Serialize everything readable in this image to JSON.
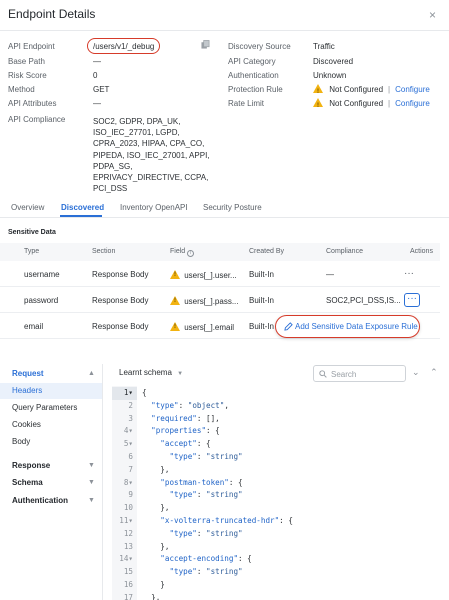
{
  "header": {
    "title": "Endpoint Details",
    "close": "×"
  },
  "details_left": [
    {
      "label": "API Endpoint",
      "value": "/users/v1/_debug"
    },
    {
      "label": "Base Path",
      "value": "—"
    },
    {
      "label": "Risk Score",
      "value": "0"
    },
    {
      "label": "Method",
      "value": "GET"
    },
    {
      "label": "API Attributes",
      "value": "—"
    },
    {
      "label": "API Compliance",
      "value": "SOC2, GDPR, DPA_UK, ISO_IEC_27701, LGPD, CPRA_2023, HIPAA, CPA_CO, PIPEDA, ISO_IEC_27001, APPI, PDPA_SG, EPRIVACY_DIRECTIVE, CCPA, PCI_DSS"
    }
  ],
  "details_right": [
    {
      "label": "Discovery Source",
      "value": "Traffic"
    },
    {
      "label": "API Category",
      "value": "Discovered"
    },
    {
      "label": "Authentication",
      "value": "Unknown"
    },
    {
      "label": "Protection Rule",
      "value": "Not Configured",
      "link": "Configure"
    },
    {
      "label": "Rate Limit",
      "value": "Not Configured",
      "link": "Configure"
    }
  ],
  "tabs": [
    "Overview",
    "Discovered",
    "Inventory OpenAPI",
    "Security Posture"
  ],
  "sensitive": {
    "title": "Sensitive Data",
    "columns": [
      "Type",
      "Section",
      "Field",
      "Created By",
      "Compliance",
      "Actions"
    ],
    "rows": [
      {
        "type": "username",
        "section": "Response Body",
        "field": "users[_].user...",
        "created_by": "Built-In",
        "compliance": "—"
      },
      {
        "type": "password",
        "section": "Response Body",
        "field": "users[_].pass...",
        "created_by": "Built-In",
        "compliance": "SOC2,PCI_DSS,IS..."
      },
      {
        "type": "email",
        "section": "Response Body",
        "field": "users[_].email",
        "created_by": "Built-In",
        "compliance": ""
      }
    ],
    "popup_action": "Add Sensitive Data Exposure Rule",
    "actions_glyph": "···"
  },
  "left_nav": {
    "request": "Request",
    "request_items": [
      "Headers",
      "Query Parameters",
      "Cookies",
      "Body"
    ],
    "groups": [
      "Response",
      "Schema",
      "Authentication"
    ]
  },
  "schema": {
    "selector": "Learnt schema",
    "search_placeholder": "Search",
    "lines": [
      {
        "n": "1",
        "t": "{"
      },
      {
        "n": "2",
        "t": "  \"type\": \"object\","
      },
      {
        "n": "3",
        "t": "  \"required\": [],"
      },
      {
        "n": "4",
        "t": "  \"properties\": {"
      },
      {
        "n": "5",
        "t": "    \"accept\": {"
      },
      {
        "n": "6",
        "t": "      \"type\": \"string\""
      },
      {
        "n": "7",
        "t": "    },"
      },
      {
        "n": "8",
        "t": "    \"postman-token\": {"
      },
      {
        "n": "9",
        "t": "      \"type\": \"string\""
      },
      {
        "n": "10",
        "t": "    },"
      },
      {
        "n": "11",
        "t": "    \"x-volterra-truncated-hdr\": {"
      },
      {
        "n": "12",
        "t": "      \"type\": \"string\""
      },
      {
        "n": "13",
        "t": "    },"
      },
      {
        "n": "14",
        "t": "    \"accept-encoding\": {"
      },
      {
        "n": "15",
        "t": "      \"type\": \"string\""
      },
      {
        "n": "16",
        "t": "    }"
      },
      {
        "n": "17",
        "t": "  },"
      }
    ]
  },
  "colors": {
    "accent": "#2a6fd6",
    "highlight": "#d63b2a",
    "warning": "#f2b311"
  }
}
